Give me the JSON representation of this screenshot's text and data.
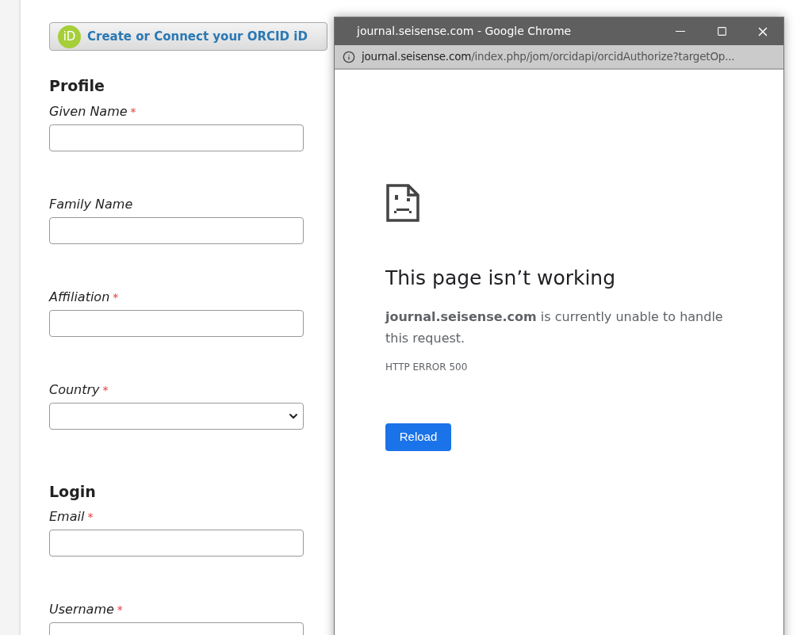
{
  "orcid_button": {
    "badge": "iD",
    "label": "Create or Connect your ORCID iD"
  },
  "sections": [
    {
      "title": "Profile",
      "fields": [
        {
          "label": "Given Name",
          "required_mark": "*",
          "kind": "text"
        },
        {
          "label": "Family Name",
          "kind": "text"
        },
        {
          "label": "Affiliation",
          "required_mark": "*",
          "kind": "text"
        },
        {
          "label": "Country",
          "required_mark": "*",
          "kind": "select"
        }
      ]
    },
    {
      "title": "Login",
      "fields": [
        {
          "label": "Email",
          "required_mark": "*",
          "kind": "text"
        },
        {
          "label": "Username",
          "required_mark": "*",
          "kind": "text"
        }
      ]
    }
  ],
  "popup": {
    "title": "journal.seisense.com - Google Chrome",
    "url_host": "journal.seisense.com",
    "url_path": "/index.php/jom/orcidapi/orcidAuthorize?targetOp...",
    "heading": "This page isn’t working",
    "message": "**journal.seisense.com** is currently unable to handle this request.",
    "error_code": "HTTP ERROR 500",
    "button": "Reload"
  }
}
